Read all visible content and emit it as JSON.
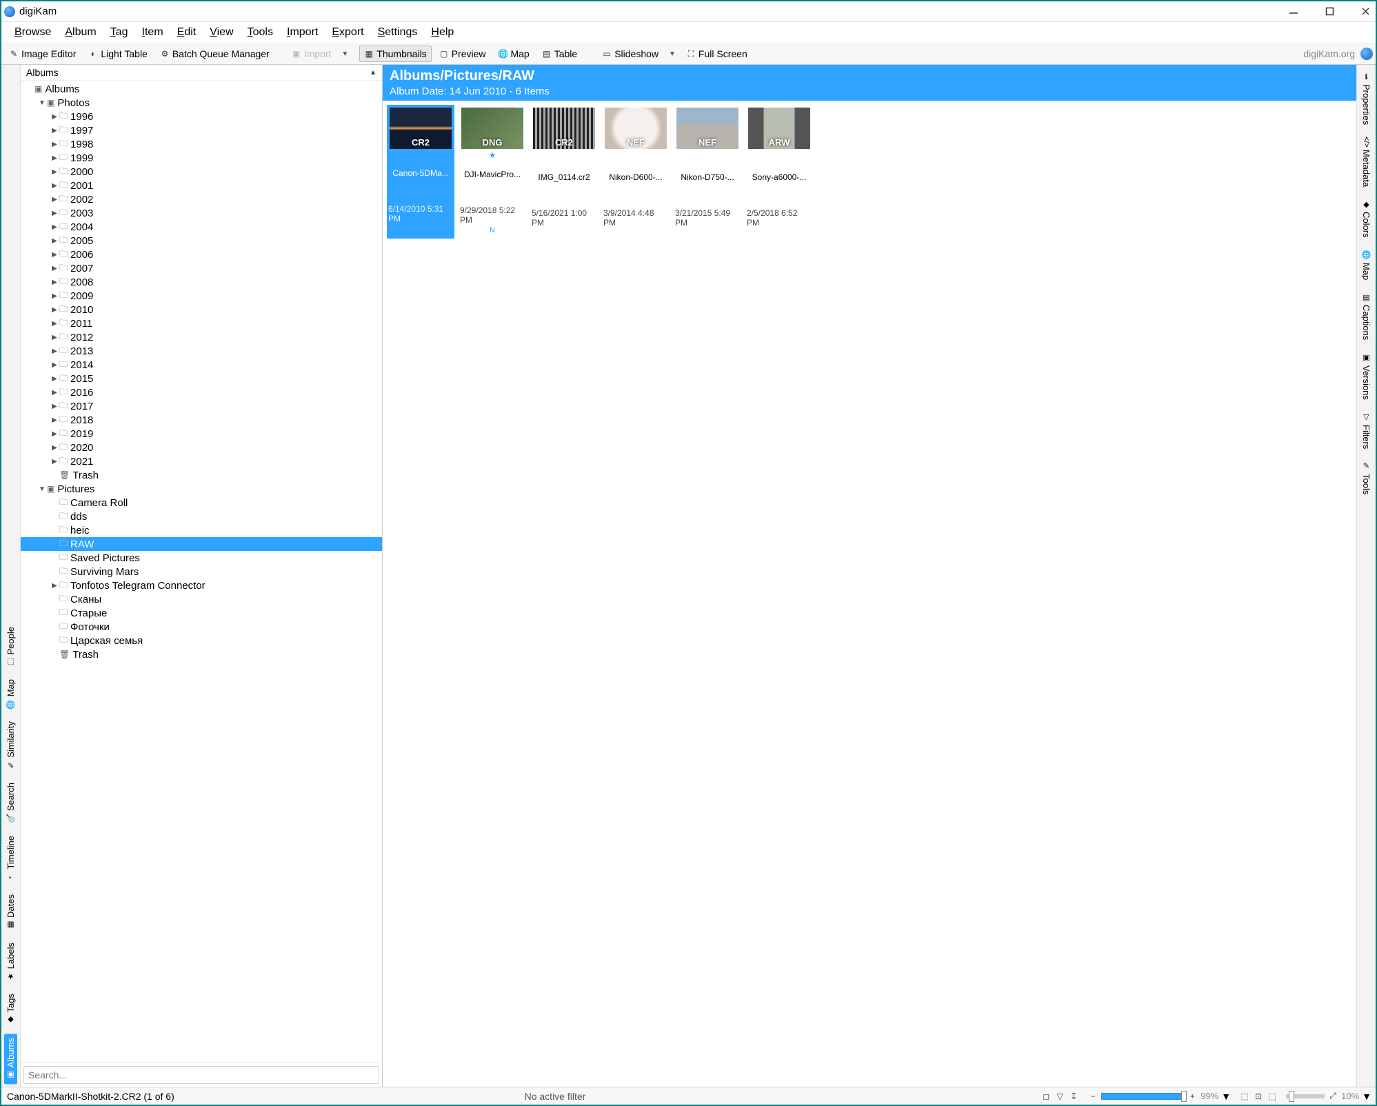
{
  "window": {
    "title": "digiKam"
  },
  "menus": [
    "Browse",
    "Album",
    "Tag",
    "Item",
    "Edit",
    "View",
    "Tools",
    "Import",
    "Export",
    "Settings",
    "Help"
  ],
  "toolbar": {
    "image_editor": "Image Editor",
    "light_table": "Light Table",
    "bqm": "Batch Queue Manager",
    "import": "Import",
    "thumbnails": "Thumbnails",
    "preview": "Preview",
    "map": "Map",
    "table": "Table",
    "slideshow": "Slideshow",
    "full_screen": "Full Screen",
    "org_link": "digiKam.org"
  },
  "left_tabs": [
    "Albums",
    "Tags",
    "Labels",
    "Dates",
    "Timeline",
    "Search",
    "Similarity",
    "Map",
    "People"
  ],
  "right_tabs": [
    "Properties",
    "Metadata",
    "Colors",
    "Map",
    "Captions",
    "Versions",
    "Filters",
    "Tools"
  ],
  "tree": {
    "header": "Albums",
    "root": "Albums",
    "photos_label": "Photos",
    "pictures_label": "Pictures",
    "year_folders": [
      "1996",
      "1997",
      "1998",
      "1999",
      "2000",
      "2001",
      "2002",
      "2003",
      "2004",
      "2005",
      "2006",
      "2007",
      "2008",
      "2009",
      "2010",
      "2011",
      "2012",
      "2013",
      "2014",
      "2015",
      "2016",
      "2017",
      "2018",
      "2019",
      "2020",
      "2021"
    ],
    "trash": "Trash",
    "pictures_children": [
      "Camera Roll",
      "dds",
      "heic",
      "RAW",
      "Saved Pictures",
      "Surviving Mars",
      "Tonfotos Telegram Connector",
      "Сканы",
      "Старые",
      "Фоточки",
      "Царская семья",
      "Trash"
    ],
    "selected": "RAW",
    "search_placeholder": "Search..."
  },
  "breadcrumb": {
    "path": "Albums/Pictures/RAW",
    "meta": "Album Date: 14 Jun 2010 - 6 Items"
  },
  "thumbs": [
    {
      "fn": "Canon-5DMa...",
      "dt": "6/14/2010 5:31 PM",
      "badge": "CR2",
      "cls": "t-sunset",
      "selected": true
    },
    {
      "fn": "DJI-MavicPro...",
      "dt": "9/29/2018 5:22 PM",
      "badge": "DNG",
      "cls": "t-drone",
      "star": true,
      "extra": "N",
      "geo": true
    },
    {
      "fn": "IMG_0114.cr2",
      "dt": "5/16/2021 1:00 PM",
      "badge": "CR2",
      "cls": "t-fence"
    },
    {
      "fn": "Nikon-D600-...",
      "dt": "3/9/2014 4:48 PM",
      "badge": "NEF",
      "cls": "t-veil"
    },
    {
      "fn": "Nikon-D750-...",
      "dt": "3/21/2015 5:49 PM",
      "badge": "NEF",
      "cls": "t-car"
    },
    {
      "fn": "Sony-a6000-...",
      "dt": "2/5/2018 6:52 PM",
      "badge": "ARW",
      "cls": "t-street"
    }
  ],
  "status": {
    "left": "Canon-5DMarkII-Shotkit-2.CR2 (1 of 6)",
    "center": "No active filter",
    "zoom_pct": "99%",
    "thumb_pct": "10%"
  }
}
